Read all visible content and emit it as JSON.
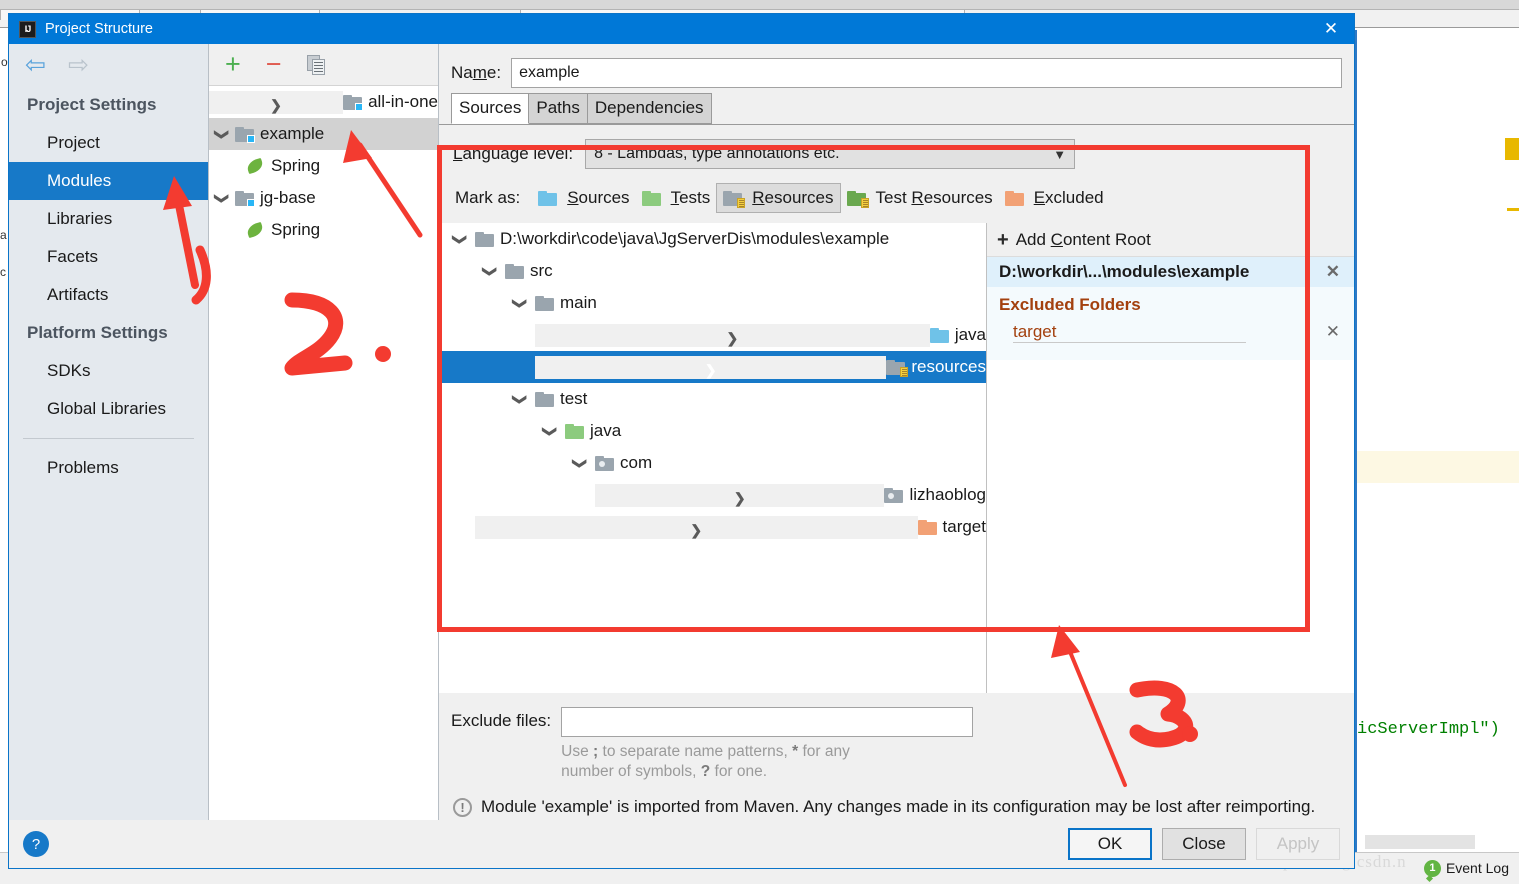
{
  "window": {
    "title": "Project Structure",
    "app_icon": "intellij-idea-icon",
    "close_label": "✕"
  },
  "nav": {
    "back_icon": "arrow-left-icon",
    "forward_icon": "arrow-right-icon",
    "groups": [
      {
        "label": "Project Settings",
        "items": [
          {
            "label": "Project",
            "active": false
          },
          {
            "label": "Modules",
            "active": true
          },
          {
            "label": "Libraries",
            "active": false
          },
          {
            "label": "Facets",
            "active": false
          },
          {
            "label": "Artifacts",
            "active": false
          }
        ]
      },
      {
        "label": "Platform Settings",
        "items": [
          {
            "label": "SDKs",
            "active": false
          },
          {
            "label": "Global Libraries",
            "active": false
          }
        ]
      }
    ],
    "problems_label": "Problems"
  },
  "modules": {
    "toolbar": {
      "add_icon": "plus-icon",
      "remove_icon": "minus-icon",
      "copy_icon": "copy-icon"
    },
    "tree": [
      {
        "label": "all-in-one",
        "kind": "module",
        "expanded": false,
        "selected": false,
        "indent": 0
      },
      {
        "label": "example",
        "kind": "module",
        "expanded": true,
        "selected": true,
        "indent": 0
      },
      {
        "label": "Spring",
        "kind": "facet",
        "expanded": null,
        "selected": false,
        "indent": 1
      },
      {
        "label": "jg-base",
        "kind": "module",
        "expanded": true,
        "selected": false,
        "indent": 0
      },
      {
        "label": "Spring",
        "kind": "facet",
        "expanded": null,
        "selected": false,
        "indent": 1
      }
    ]
  },
  "detail": {
    "name_label_pre": "Na",
    "name_label_mnemonic": "m",
    "name_label_post": "e:",
    "name_value": "example",
    "name_placeholder": "",
    "tabs": [
      {
        "label": "Sources",
        "active": true
      },
      {
        "label": "Paths",
        "active": false
      },
      {
        "label": "Dependencies",
        "active": false
      }
    ],
    "language_level": {
      "label_mnemonic": "L",
      "label_rest": "anguage level:",
      "value": "8 - Lambdas, type annotations etc.",
      "caret_icon": "chevron-down-icon"
    },
    "mark_as": {
      "label": "Mark as:",
      "options": [
        {
          "pre": "",
          "mnemonic": "S",
          "post": "ources",
          "color": "blue",
          "pressed": false,
          "icon": "folder-sources-icon"
        },
        {
          "pre": "",
          "mnemonic": "T",
          "post": "ests",
          "color": "green",
          "pressed": false,
          "icon": "folder-tests-icon"
        },
        {
          "pre": "",
          "mnemonic": "R",
          "post": "esources",
          "color": "grey-res",
          "pressed": true,
          "icon": "folder-resources-icon"
        },
        {
          "pre": "Test ",
          "mnemonic": "R",
          "post": "esources",
          "color": "teal-res",
          "pressed": false,
          "icon": "folder-test-resources-icon"
        },
        {
          "pre": "",
          "mnemonic": "E",
          "post": "xcluded",
          "color": "orange",
          "pressed": false,
          "icon": "folder-excluded-icon"
        }
      ]
    },
    "content_tree": [
      {
        "label": "D:\\workdir\\code\\java\\JgServerDis\\modules\\example",
        "indent": 0,
        "chev": "down",
        "icon": "folder-grey",
        "selected": false
      },
      {
        "label": "src",
        "indent": 1,
        "chev": "down",
        "icon": "folder-grey",
        "selected": false
      },
      {
        "label": "main",
        "indent": 2,
        "chev": "down",
        "icon": "folder-grey",
        "selected": false
      },
      {
        "label": "java",
        "indent": 3,
        "chev": "right",
        "icon": "folder-blue",
        "selected": false
      },
      {
        "label": "resources",
        "indent": 3,
        "chev": "right",
        "icon": "folder-resources",
        "selected": true
      },
      {
        "label": "test",
        "indent": 2,
        "chev": "down",
        "icon": "folder-grey",
        "selected": false
      },
      {
        "label": "java",
        "indent": 3,
        "chev": "down",
        "icon": "folder-green",
        "selected": false
      },
      {
        "label": "com",
        "indent": 4,
        "chev": "down",
        "icon": "package",
        "selected": false
      },
      {
        "label": "lizhaoblog",
        "indent": 5,
        "chev": "right",
        "icon": "package",
        "selected": false
      },
      {
        "label": "target",
        "indent": 1,
        "chev": "right",
        "icon": "folder-orange",
        "selected": false
      }
    ],
    "content_roots": {
      "add_label_pre": "Add ",
      "add_label_mnemonic": "C",
      "add_label_post": "ontent Root",
      "add_icon": "plus-icon",
      "root_path": "D:\\workdir\\...\\modules\\example",
      "root_remove_icon": "close-icon",
      "excluded_title": "Excluded Folders",
      "excluded": [
        {
          "name": "target",
          "remove_icon": "close-icon"
        }
      ]
    },
    "exclude_files": {
      "label": "Exclude files:",
      "value": "",
      "placeholder": "",
      "hint_line1_a": "Use ",
      "hint_line1_sep": ";",
      "hint_line1_b": " to separate name patterns, ",
      "hint_line1_star": "*",
      "hint_line1_c": " for any",
      "hint_line2_a": "number of symbols, ",
      "hint_line2_q": "?",
      "hint_line2_b": " for one."
    },
    "notice": {
      "icon": "info-icon",
      "text": "Module 'example' is imported from Maven. Any changes made in its configuration may be lost after reimporting."
    }
  },
  "footer": {
    "help_icon": "help-icon",
    "help_label": "?",
    "buttons": [
      {
        "label": "OK",
        "style": "default"
      },
      {
        "label": "Close",
        "style": "normal"
      },
      {
        "label": "Apply",
        "style": "disabled"
      }
    ]
  },
  "background": {
    "code_fragment": "icServerImpl\")",
    "status_event_log": "Event Log",
    "status_event_count": "1",
    "watermark": "https://blog.csdn.n"
  },
  "annotations": {
    "marker_2": "2.",
    "marker_3": "3.",
    "highlight_color": "#f33b30"
  }
}
